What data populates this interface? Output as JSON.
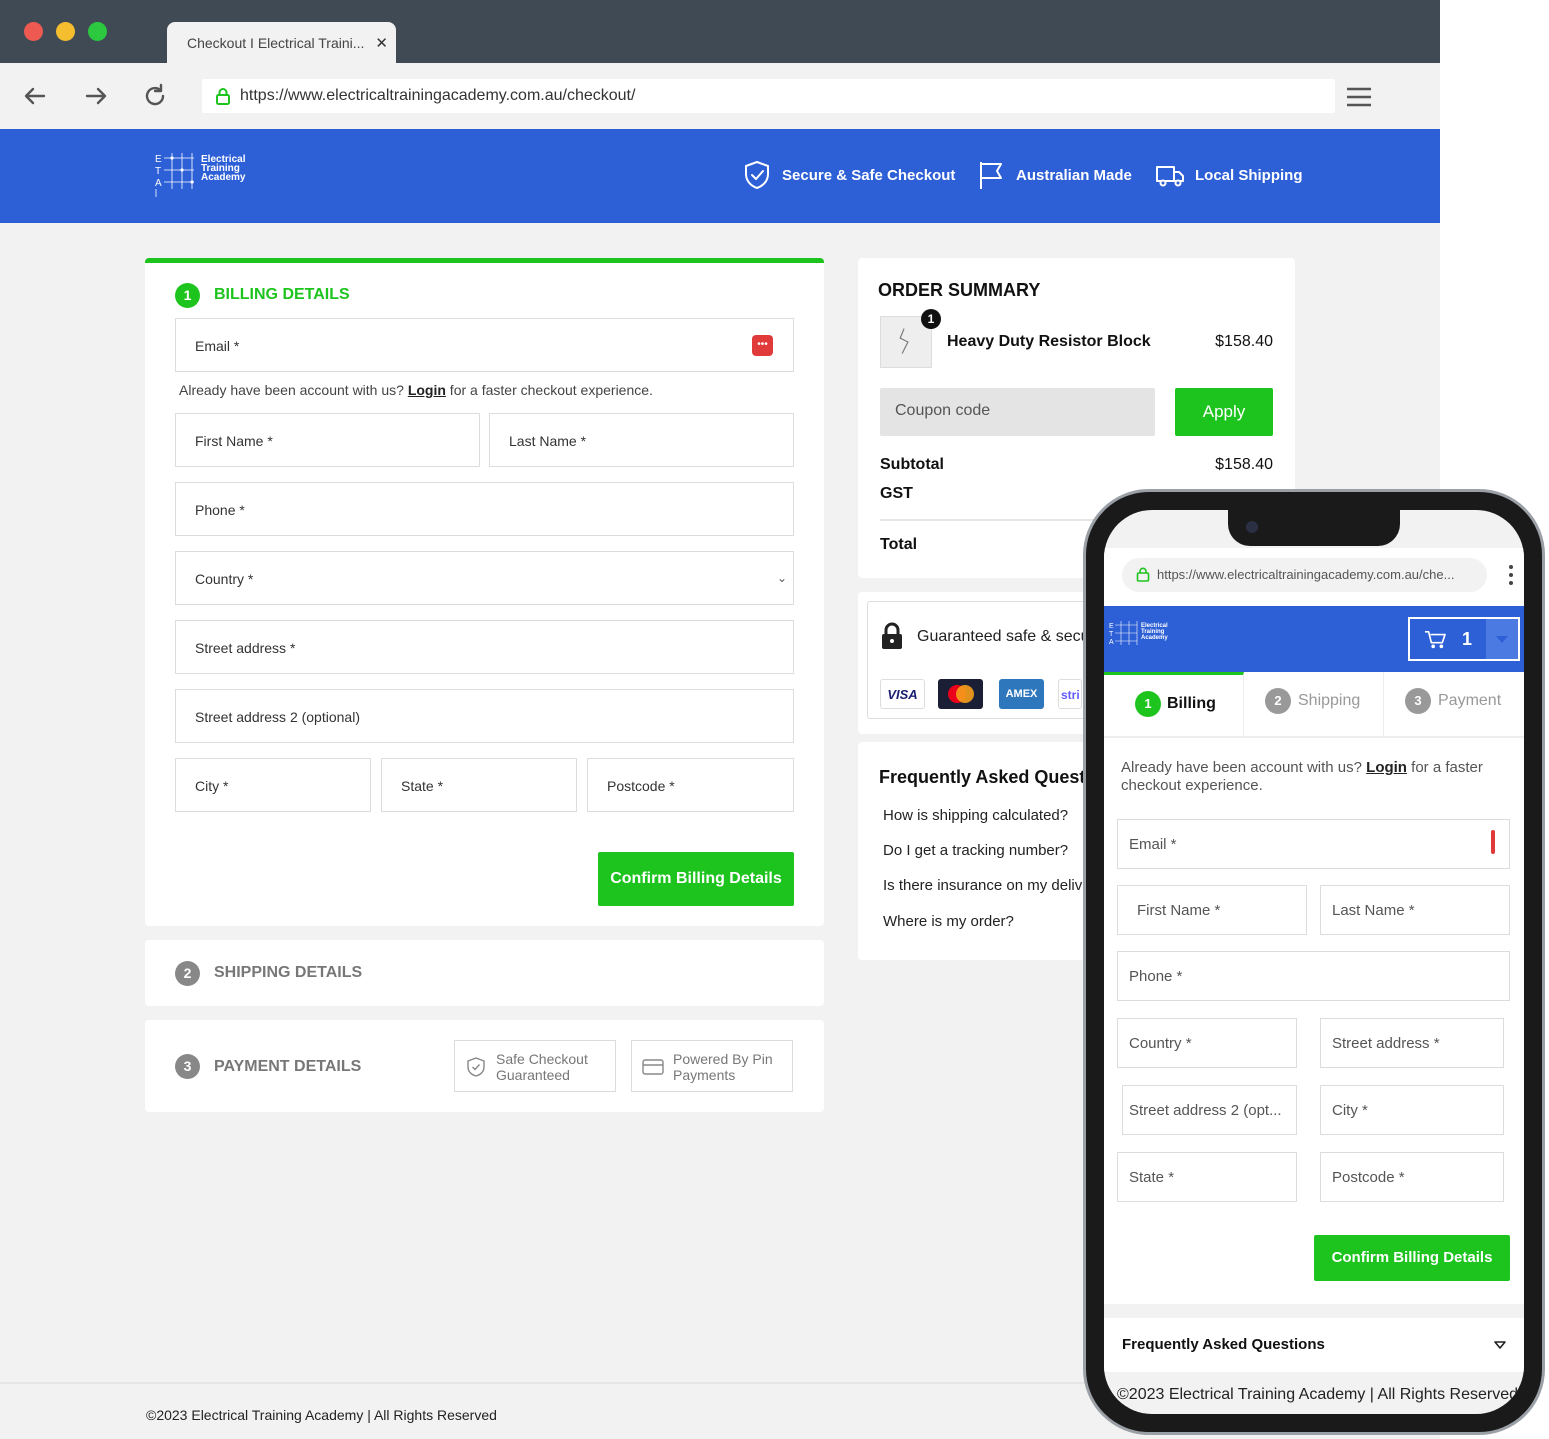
{
  "browser": {
    "tab_title": "Checkout I Electrical Traini...",
    "tab_close": "✕",
    "url": "https://www.electricaltrainingacademy.com.au/checkout/"
  },
  "header": {
    "logo_lines": [
      "Electrical",
      "Training",
      "Academy"
    ],
    "trust_items": [
      {
        "icon": "shield-check-icon",
        "label": "Secure & Safe Checkout"
      },
      {
        "icon": "flag-icon",
        "label": "Australian Made"
      },
      {
        "icon": "truck-icon",
        "label": "Local Shipping"
      }
    ],
    "brand_color": "#2d5fd6",
    "accent_color": "#1ec41e"
  },
  "billing": {
    "step": "1",
    "title": "BILLING DETAILS",
    "email_label": "Email *",
    "hint_prefix": "Already have been account with us? ",
    "hint_link": "Login",
    "hint_suffix": " for a faster checkout experience.",
    "first_name": "First Name *",
    "last_name": "Last Name *",
    "phone": "Phone *",
    "country": "Country *",
    "street": "Street address *",
    "street2": "Street address 2 (optional)",
    "city": "City *",
    "state": "State *",
    "postcode": "Postcode *",
    "confirm": "Confirm Billing Details"
  },
  "shipping": {
    "step": "2",
    "title": "SHIPPING DETAILS"
  },
  "payment": {
    "step": "3",
    "title": "PAYMENT DETAILS",
    "badge1_l1": "Safe Checkout",
    "badge1_l2": "Guaranteed",
    "badge2_l1": "Powered By Pin",
    "badge2_l2": "Payments"
  },
  "summary": {
    "title": "ORDER SUMMARY",
    "item_count": "1",
    "item_name": "Heavy Duty Resistor Block",
    "item_price": "$158.40",
    "coupon_placeholder": "Coupon code",
    "apply": "Apply",
    "subtotal_label": "Subtotal",
    "subtotal_value": "$158.40",
    "gst_label": "GST",
    "total_label": "Total"
  },
  "secure": {
    "text": "Guaranteed safe & secu",
    "cards": [
      "VISA",
      "mastercard",
      "AMEX",
      "stri"
    ]
  },
  "faq": {
    "title": "Frequently Asked Questic",
    "questions": [
      "How is shipping calculated?",
      "Do I get a tracking number?",
      "Is there insurance on my deliv",
      "Where is my order?"
    ]
  },
  "footer": "©2023 Electrical Training Academy | All Rights Reserved",
  "mobile": {
    "url": "https://www.electricaltrainingacademy.com.au/che...",
    "cart_count": "1",
    "steps": [
      {
        "n": "1",
        "label": "Billing"
      },
      {
        "n": "2",
        "label": "Shipping"
      },
      {
        "n": "3",
        "label": "Payment"
      }
    ],
    "hint_prefix": "Already have been account with us? ",
    "hint_link": "Login",
    "hint_suffix": " for a faster checkout experience.",
    "email": "Email *",
    "first_name": "First Name *",
    "last_name": "Last Name *",
    "phone": "Phone *",
    "country": "Country *",
    "street": "Street address *",
    "street2": "Street address 2 (opt...",
    "city": "City *",
    "state": "State *",
    "postcode": "Postcode *",
    "confirm": "Confirm Billing Details",
    "faq_title": "Frequently Asked Questions",
    "footer": "©2023 Electrical Training Academy | All Rights Reserved"
  }
}
